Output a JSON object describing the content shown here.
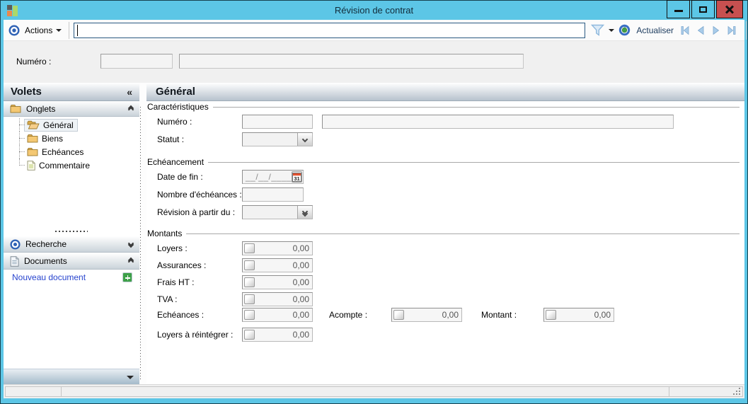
{
  "window": {
    "title": "Révision de contrat"
  },
  "toolbar": {
    "actions_label": "Actions",
    "search_value": "",
    "refresh_label": "Actualiser"
  },
  "header_fields": {
    "numero_label": "Numéro :",
    "numero_value1": "",
    "numero_value2": ""
  },
  "sidebar": {
    "title": "Volets",
    "onglets_label": "Onglets",
    "tree": [
      "Général",
      "Biens",
      "Echéances",
      "Commentaire"
    ],
    "selected_item": "Général",
    "recherche_label": "Recherche",
    "documents_label": "Documents",
    "new_document_label": "Nouveau document"
  },
  "main": {
    "title": "Général",
    "caracteristiques": {
      "label": "Caractéristiques",
      "numero_label": "Numéro :",
      "numero_value1": "",
      "numero_value2": "",
      "statut_label": "Statut :",
      "statut_value": ""
    },
    "echeancement": {
      "label": "Echéancement",
      "date_fin_label": "Date de fin :",
      "date_mask": "__/__/____",
      "calendar_day": "31",
      "nb_echeances_label": "Nombre d'échéances :",
      "nb_echeances_value": "",
      "revision_label": "Révision à partir du :",
      "revision_value": ""
    },
    "montants": {
      "label": "Montants",
      "rows": [
        {
          "label": "Loyers :",
          "value": "0,00"
        },
        {
          "label": "Assurances :",
          "value": "0,00"
        },
        {
          "label": "Frais HT :",
          "value": "0,00"
        },
        {
          "label": "TVA :",
          "value": "0,00"
        },
        {
          "label": "Echéances :",
          "value": "0,00"
        },
        {
          "label": "Loyers à réintégrer :",
          "value": "0,00"
        }
      ],
      "acompte": {
        "label": "Acompte :",
        "value": "0,00"
      },
      "montant": {
        "label": "Montant :",
        "value": "0,00"
      }
    }
  },
  "icons": {
    "app-icon": "colored-squares-logo",
    "actions-target-icon": "blue-ring-dot",
    "filter-icon": "funnel",
    "refresh-icon": "blue-circle-green-dot",
    "nav-first-icon": "bar-left-triangle",
    "nav-prev-icon": "left-triangle",
    "nav-next-icon": "right-triangle",
    "nav-last-icon": "right-triangle-bar",
    "collapse-icon": "«",
    "chevron-double-up": "^^",
    "chevron-double-down": "vv",
    "folder-icon": "manila-folder",
    "folder-open-icon": "open-manila-folder",
    "document-icon": "page-with-lines",
    "search-target-icon": "blue-ring-dot",
    "plus-icon": "+",
    "calendar-icon": "calendar-31",
    "minimize-icon": "–",
    "maximize-icon": "□",
    "close-icon": "x",
    "resize-grip-icon": "diagonal-dots"
  },
  "colors": {
    "titlebar": "#5CC6E6",
    "close_button": "#C75050",
    "link": "#2743CE",
    "nav_arrow": "#A9CCEA",
    "folder": "#F4C873",
    "plus_green": "#3DA048",
    "calendar_red": "#E1502E"
  }
}
